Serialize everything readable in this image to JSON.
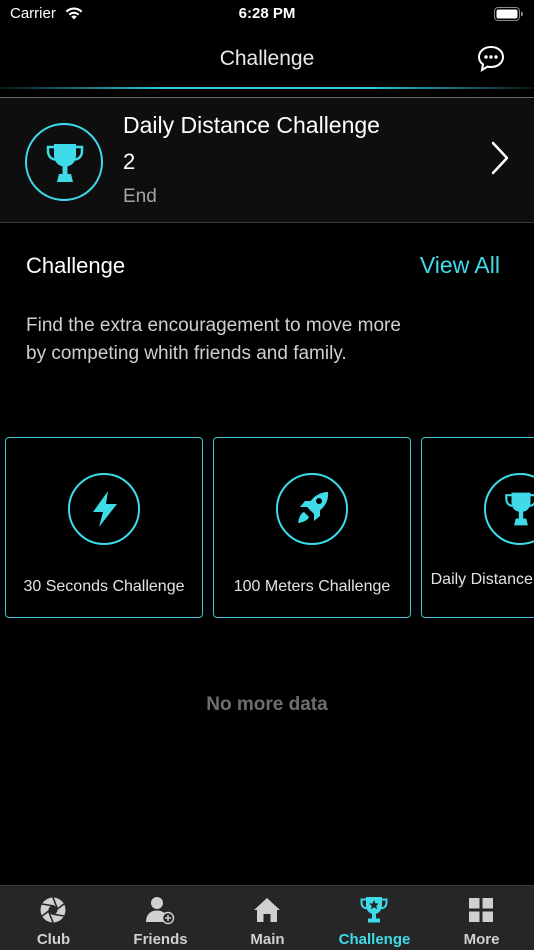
{
  "status_bar": {
    "carrier": "Carrier",
    "time": "6:28 PM"
  },
  "nav": {
    "title": "Challenge"
  },
  "current_challenge": {
    "name": "Daily Distance Challenge",
    "count": "2",
    "status": "End"
  },
  "section": {
    "title": "Challenge",
    "view_all": "View All",
    "description": "Find the extra encouragement to move more\n by competing whith friends and family."
  },
  "challenges": [
    {
      "label": "30 Seconds Challenge",
      "icon": "lightning-icon"
    },
    {
      "label": "100 Meters Challenge",
      "icon": "rocket-icon"
    },
    {
      "label": "Daily Distance Challenge",
      "icon": "trophy-icon"
    }
  ],
  "footer": {
    "no_more": "No more data"
  },
  "tabs": [
    {
      "label": "Club",
      "icon": "aperture-icon"
    },
    {
      "label": "Friends",
      "icon": "add-friend-icon"
    },
    {
      "label": "Main",
      "icon": "home-icon"
    },
    {
      "label": "Challenge",
      "icon": "trophy-star-icon",
      "active": true
    },
    {
      "label": "More",
      "icon": "grid-icon"
    }
  ],
  "colors": {
    "accent": "#3fdbe8",
    "background": "#000000",
    "tab_bar": "#262626"
  }
}
